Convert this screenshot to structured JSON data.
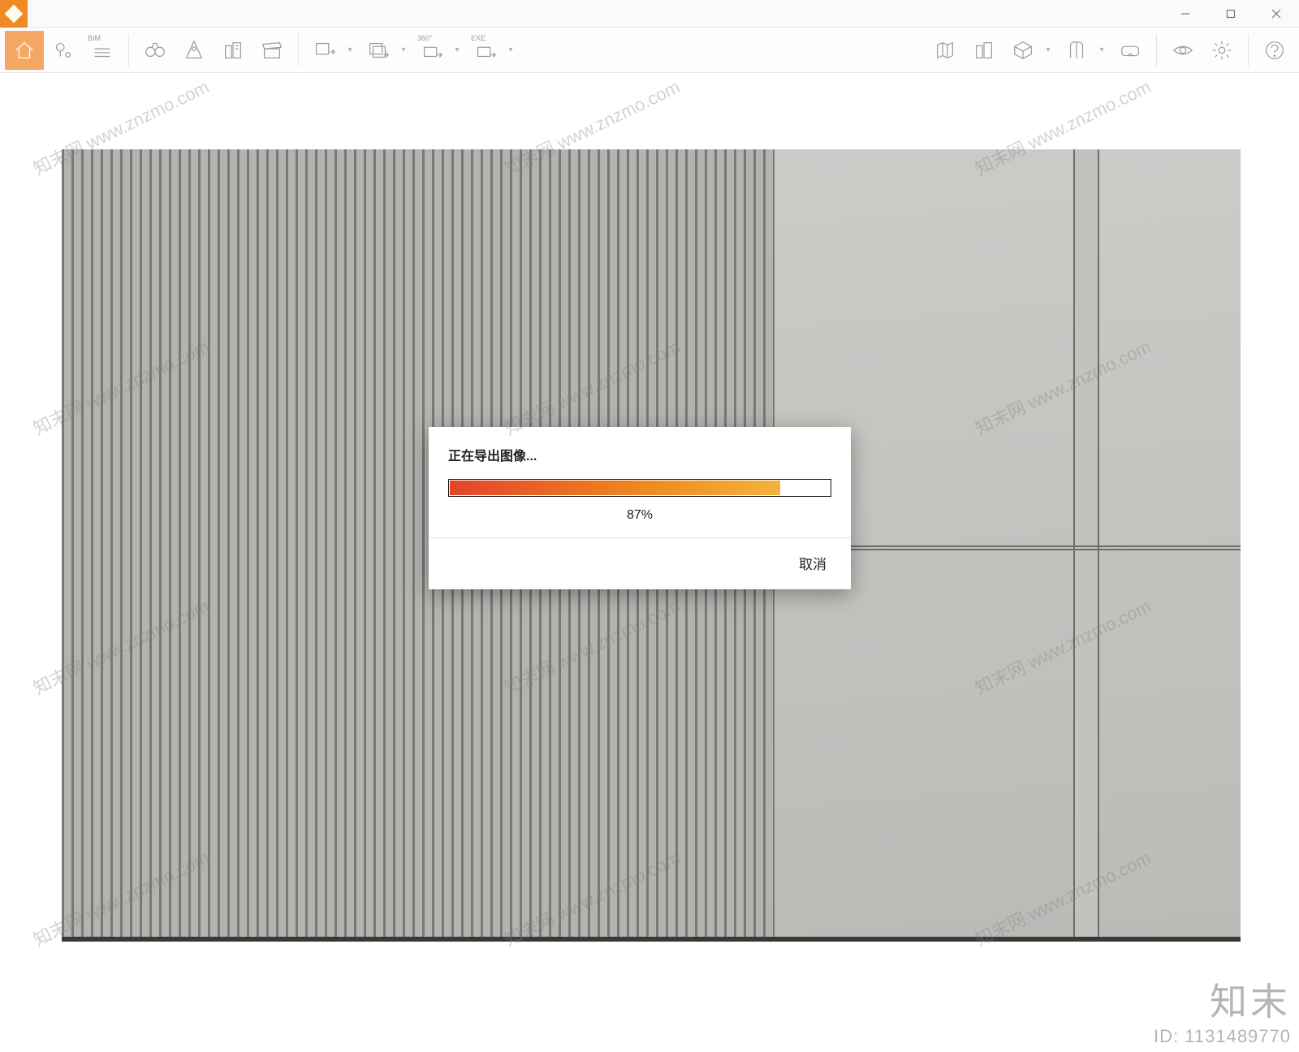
{
  "window": {
    "minimize_tooltip": "Minimize",
    "maximize_tooltip": "Maximize",
    "close_tooltip": "Close"
  },
  "toolbar": {
    "home": "home",
    "location": "location",
    "bim_label": "BIM",
    "binoculars": "binoculars",
    "walk": "walk",
    "buildings": "buildings",
    "clapper": "clapper",
    "export_img": "export-image",
    "export_seq": "export-sequence",
    "export_360_label": "360°",
    "export_exe_label": "EXE",
    "map": "map",
    "buildings_right": "buildings",
    "cube": "cube",
    "gate": "gate",
    "vr": "vr",
    "eye": "eye",
    "gear": "gear",
    "help": "help"
  },
  "dialog": {
    "title": "正在导出图像...",
    "percent_value": 87,
    "percent_text": "87%",
    "cancel": "取消"
  },
  "watermark": {
    "repeat": "知末网 www.znzmo.com",
    "brand": "知末",
    "id_label": "ID: 1131489770"
  }
}
